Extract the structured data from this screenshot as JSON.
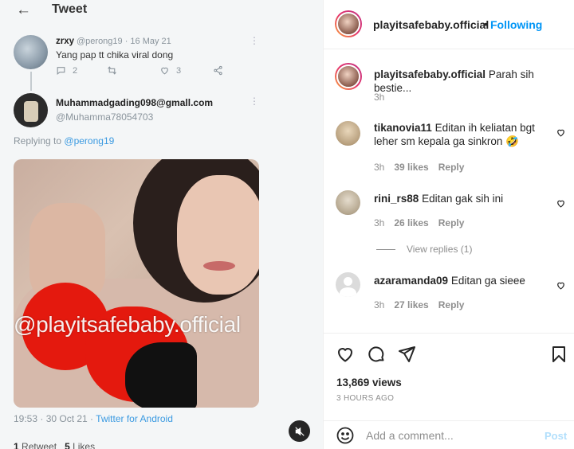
{
  "tweet": {
    "back_icon": "←",
    "title": "Tweet",
    "reply1": {
      "name": "zrxy",
      "handle": "@perong19 · 16 May 21",
      "text": "Yang pap tt chika viral dong",
      "reply_count": "2",
      "like_count": "3",
      "more": "⋮"
    },
    "reply2": {
      "name": "Muhammadgading098@gmall.com",
      "handle": "@Muhamma78054703",
      "more": "⋮",
      "replying_prefix": "Replying to",
      "replying_to": "@perong19"
    },
    "watermark": "@playitsafebaby.official",
    "timestamp": "19:53 · 30 Oct 21 · ",
    "client": "Twitter for Android",
    "retweets": "1",
    "retweets_label": " Retweet",
    "likes": "5",
    "likes_label": " Likes"
  },
  "post": {
    "username": "playitsafebaby.official",
    "separator": "•",
    "follow_label": "Following",
    "caption": {
      "user": "playitsafebaby.official",
      "text": "Parah sih bestie...",
      "time": "3h"
    },
    "comments": [
      {
        "user": "tikanovia11",
        "text": "Editan ih keliatan bgt leher sm kepala ga sinkron 🤣",
        "time": "3h",
        "likes": "39 likes",
        "reply": "Reply"
      },
      {
        "user": "rini_rs88",
        "text": "Editan gak sih ini",
        "time": "3h",
        "likes": "26 likes",
        "reply": "Reply"
      },
      {
        "user": "azaramanda09",
        "text": "Editan ga sieee",
        "time": "3h",
        "likes": "27 likes",
        "reply": "Reply"
      }
    ],
    "view_replies": "View replies (1)",
    "views": "13,869 views",
    "time_ago": "3 HOURS AGO",
    "comment_placeholder": "Add a comment...",
    "post_label": "Post"
  },
  "icons": {
    "like": "heart-icon",
    "comment": "comment-icon",
    "share": "share-icon",
    "save": "bookmark-icon",
    "emoji": "emoji-icon",
    "mute": "muted-speaker-icon"
  },
  "colors": {
    "link_blue": "#0095f6",
    "twitter_blue": "#3b9ae1",
    "post_disabled": "#b2dffc"
  }
}
